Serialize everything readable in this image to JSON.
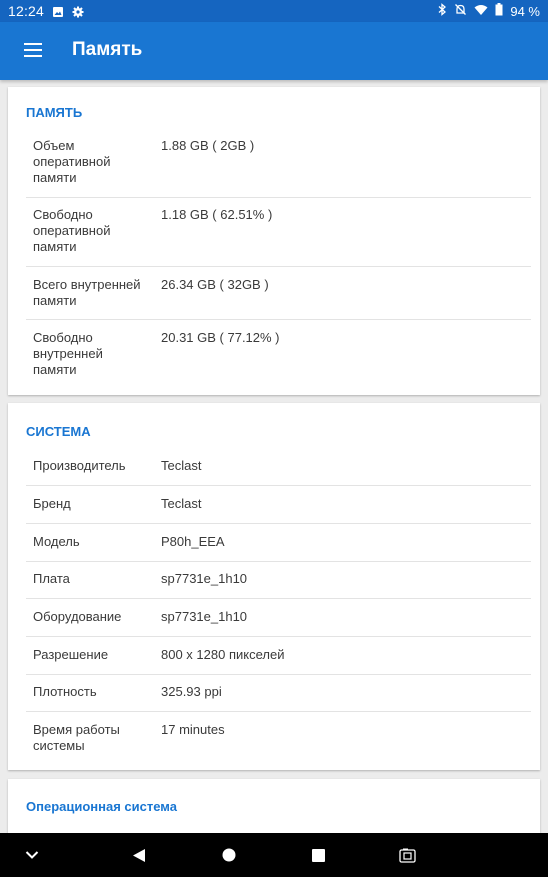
{
  "status": {
    "time": "12:24",
    "battery": "94 %",
    "left_icons": [
      "image-icon",
      "gear-icon"
    ],
    "right_icons": [
      "bluetooth-icon",
      "notifications-off-icon",
      "wifi-icon",
      "battery-icon"
    ]
  },
  "appbar": {
    "title": "Память"
  },
  "memory": {
    "title": "ПАМЯТЬ",
    "rows": [
      {
        "key": "Объем оперативной памяти",
        "value": "1.88 GB ( 2GB )"
      },
      {
        "key": "Свободно оперативной памяти",
        "value": "1.18 GB ( 62.51% )"
      },
      {
        "key": "Всего внутренней памяти",
        "value": "26.34 GB ( 32GB )"
      },
      {
        "key": "Свободно внутренней памяти",
        "value": "20.31 GB ( 77.12% )"
      }
    ]
  },
  "system": {
    "title": "СИСТЕМА",
    "rows": [
      {
        "key": "Производитель",
        "value": "Teclast"
      },
      {
        "key": "Бренд",
        "value": "Teclast"
      },
      {
        "key": "Модель",
        "value": "P80h_EEA"
      },
      {
        "key": "Плата",
        "value": "sp7731e_1h10"
      },
      {
        "key": "Оборудование",
        "value": "sp7731e_1h10"
      },
      {
        "key": "Разрешение",
        "value": "800 x 1280 пикселей"
      },
      {
        "key": "Плотность",
        "value": "325.93 ppi"
      },
      {
        "key": "Время работы системы",
        "value": "17 minutes"
      }
    ]
  },
  "os": {
    "title": "Операционная система"
  },
  "navbar": {
    "items": [
      "chevron-down-icon",
      "back-icon",
      "home-icon",
      "recents-icon",
      "screenshot-icon"
    ]
  },
  "colors": {
    "appbar": "#1976d2",
    "statusbar": "#1565c0",
    "accent": "#1976d2"
  }
}
